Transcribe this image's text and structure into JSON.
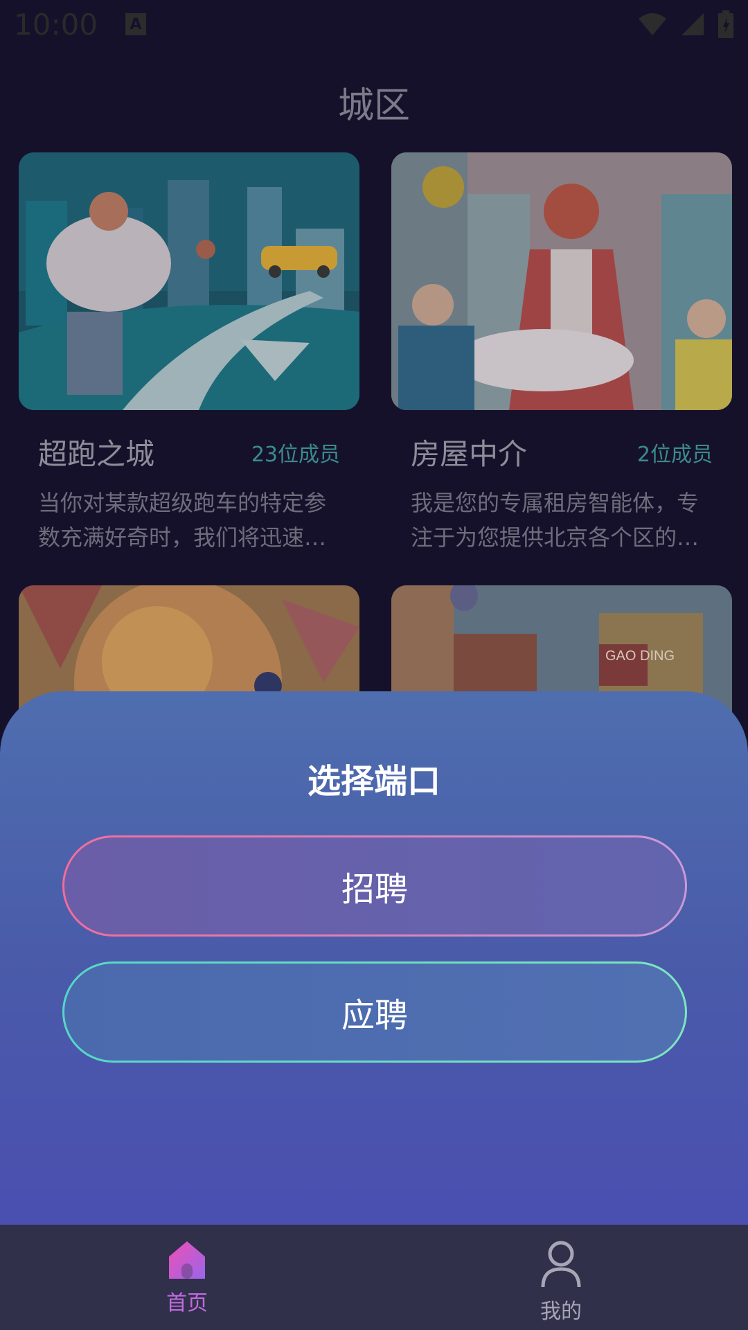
{
  "status_bar": {
    "time": "10:00",
    "notification_icon": "a-icon"
  },
  "header": {
    "title": "城区"
  },
  "cards": [
    {
      "title": "超跑之城",
      "members": "23位成员",
      "description": "当你对某款超级跑车的特定参数充满好奇时，我们将迅速…"
    },
    {
      "title": "房屋中介",
      "members": "2位成员",
      "description": "我是您的专属租房智能体，专注于为您提供北京各个区的…"
    },
    {
      "title": "",
      "members": "",
      "description": ""
    },
    {
      "title": "",
      "members": "",
      "description": "",
      "sign_text": "GAO DING"
    }
  ],
  "sheet": {
    "title": "选择端口",
    "recruit_label": "招聘",
    "apply_label": "应聘"
  },
  "nav": {
    "home_label": "首页",
    "mine_label": "我的"
  },
  "colors": {
    "accent": "#c46ae0",
    "sheet_top": "#4e6eaf",
    "sheet_bottom": "#4a4fb0",
    "nav_bg": "#30304b"
  }
}
